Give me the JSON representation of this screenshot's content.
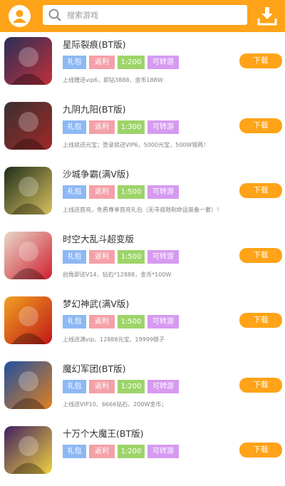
{
  "header": {
    "search_placeholder": "搜索游戏",
    "accent_color": "#ffa318",
    "icons": [
      "user-avatar-icon",
      "search-icon",
      "download-icon"
    ]
  },
  "games": [
    {
      "title": "星际裂痕(BT版)",
      "tags": [
        "礼包",
        "返利",
        "1:200",
        "可转游"
      ],
      "desc": "上线赠送vip6，即钻3888，金币188W",
      "download": "下载",
      "icon_colors": [
        "#2a2f58",
        "#c0303a"
      ]
    },
    {
      "title": "九阴九阳(BT版)",
      "tags": [
        "礼包",
        "返利",
        "1:300",
        "可转游"
      ],
      "desc": "上线就送元宝；登录就送VIP6，5000元宝，500W银两！",
      "download": "下载",
      "icon_colors": [
        "#3a3030",
        "#a02828"
      ]
    },
    {
      "title": "沙城争霸(满V版)",
      "tags": [
        "礼包",
        "返利",
        "1:500",
        "可转游"
      ],
      "desc": "上线送首充，免费尊享首充礼包（无寻叔限制命运装备一套）！",
      "download": "下载",
      "icon_colors": [
        "#1e2e1a",
        "#d8c060"
      ]
    },
    {
      "title": "时空大乱斗超变版",
      "tags": [
        "礼包",
        "返利",
        "1:500",
        "可转游"
      ],
      "desc": "创角即送V14，钻石*12888，金币*100W",
      "download": "下载",
      "icon_colors": [
        "#e8d8c8",
        "#d02030"
      ]
    },
    {
      "title": "梦幻神武(满V版)",
      "tags": [
        "礼包",
        "返利",
        "1:500",
        "可转游"
      ],
      "desc": "上线送满vip、12888元宝、19999银子",
      "download": "下载",
      "icon_colors": [
        "#f0a020",
        "#c01818"
      ]
    },
    {
      "title": "魔幻军团(BT版)",
      "tags": [
        "礼包",
        "返利",
        "1:200",
        "可转游"
      ],
      "desc": "上线送VIP10、6666钻石、200W金币；",
      "download": "下载",
      "icon_colors": [
        "#2050a0",
        "#e08020"
      ]
    },
    {
      "title": "十万个大魔王(BT版)",
      "tags": [
        "礼包",
        "返利",
        "1:200",
        "可转游"
      ],
      "desc": "",
      "download": "下载",
      "icon_colors": [
        "#402060",
        "#f0d040"
      ]
    }
  ]
}
